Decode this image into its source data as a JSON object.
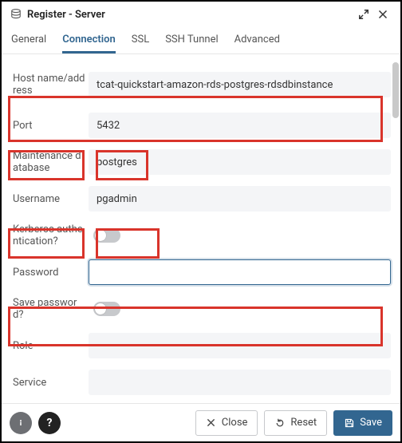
{
  "title": "Register - Server",
  "tabs": [
    "General",
    "Connection",
    "SSL",
    "SSH Tunnel",
    "Advanced"
  ],
  "active_tab_index": 1,
  "fields": {
    "host": {
      "label": "Host name/address",
      "value": "tcat-quickstart-amazon-rds-postgres-rdsdbinstance"
    },
    "port": {
      "label": "Port",
      "value": "5432"
    },
    "maintdb": {
      "label": "Maintenance database",
      "value": "postgres"
    },
    "username": {
      "label": "Username",
      "value": "pgadmin"
    },
    "kerberos": {
      "label": "Kerberos authentication?",
      "value": false
    },
    "password": {
      "label": "Password",
      "value": ""
    },
    "savepass": {
      "label": "Save password?",
      "value": false
    },
    "role": {
      "label": "Role",
      "value": ""
    },
    "service": {
      "label": "Service",
      "value": ""
    }
  },
  "footer": {
    "close": "Close",
    "reset": "Reset",
    "save": "Save"
  }
}
